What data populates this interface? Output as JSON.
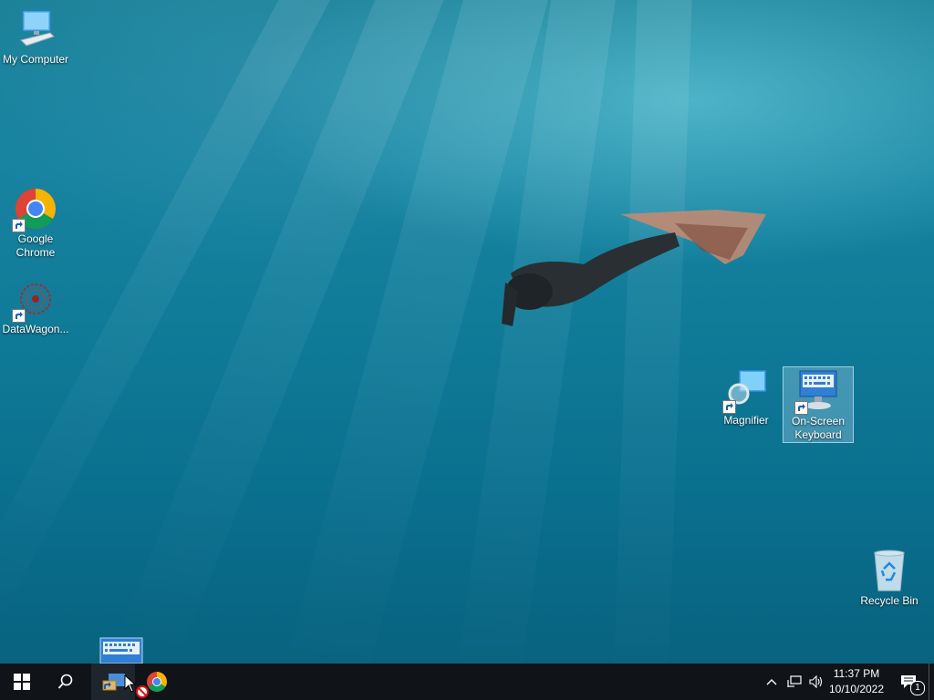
{
  "desktop": {
    "icons": [
      {
        "label": "My Computer"
      },
      {
        "label": "Google Chrome"
      },
      {
        "label": "DataWagon..."
      },
      {
        "label": "Magnifier"
      },
      {
        "label": "On-Screen Keyboard"
      },
      {
        "label": "Recycle Bin"
      }
    ]
  },
  "taskbar": {
    "start": "windows-logo-icon",
    "search": "search-icon",
    "pinned": [
      "on-screen-keyboard-icon",
      "chrome-icon"
    ],
    "tray": {
      "time": "11:37 PM",
      "date": "10/10/2022",
      "notification_count": "1"
    }
  },
  "colors": {
    "taskbar": "#101418",
    "selection": "#aad2eb",
    "water": "#0f7b98"
  }
}
